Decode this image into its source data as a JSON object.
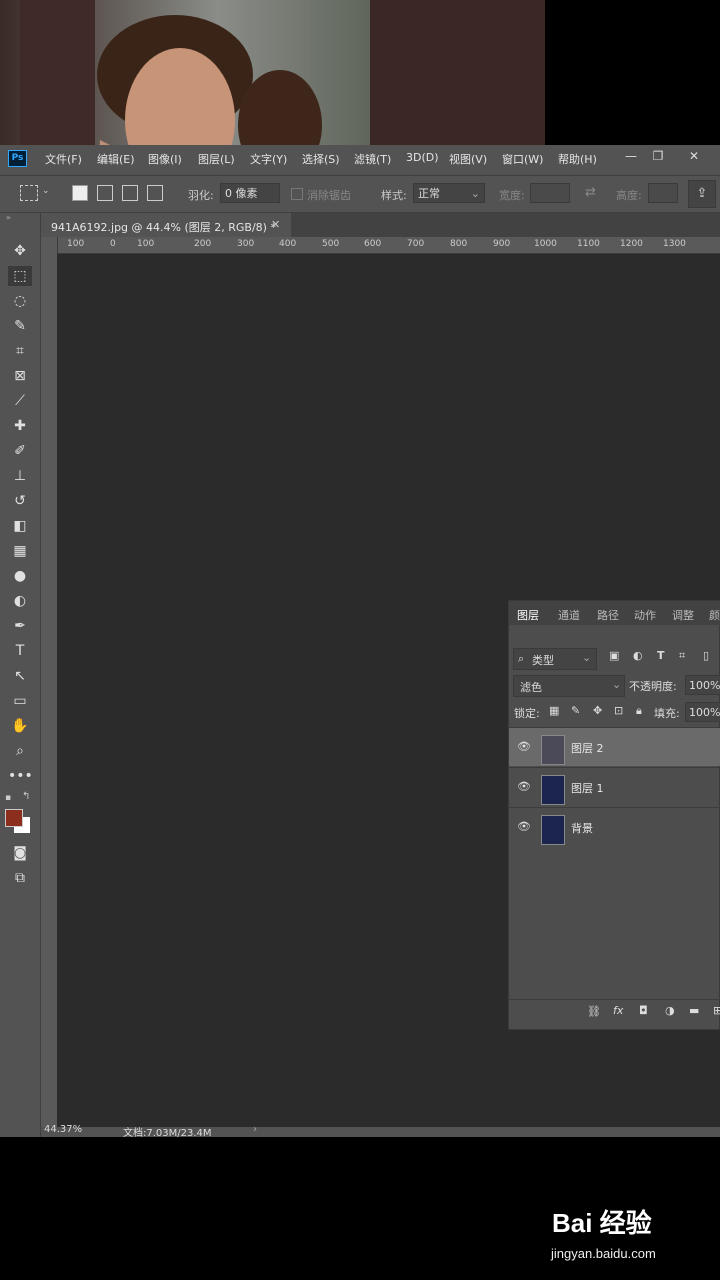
{
  "menubar": {
    "app_icon": "Ps",
    "items": [
      "文件(F)",
      "编辑(E)",
      "图像(I)",
      "图层(L)",
      "文字(Y)",
      "选择(S)",
      "滤镜(T)",
      "3D(D)",
      "视图(V)",
      "窗口(W)",
      "帮助(H)"
    ],
    "window_controls": [
      "minimize-icon",
      "restore-icon",
      "close-icon"
    ]
  },
  "options": {
    "feather_label": "羽化:",
    "feather_value": "0 像素",
    "antialias_label": "消除锯齿",
    "style_label": "样式:",
    "style_value": "正常",
    "width_label": "宽度:",
    "height_label": "高度:"
  },
  "document": {
    "tab_title": "941A6192.jpg @ 44.4% (图层 2, RGB/8) *",
    "ruler_ticks": [
      "100",
      "0",
      "100",
      "200",
      "300",
      "400",
      "500",
      "600",
      "700",
      "800",
      "900",
      "1000",
      "1100",
      "1200",
      "1300"
    ]
  },
  "status": {
    "zoom": "44.37%",
    "doc_info": "文档:7.03M/23.4M"
  },
  "layers_panel": {
    "tabs": [
      "图层",
      "通道",
      "路径",
      "动作",
      "调整",
      "颜"
    ],
    "filter_label": "类型",
    "blend_mode": "滤色",
    "opacity_label": "不透明度:",
    "opacity_value": "100%",
    "lock_label": "锁定:",
    "fill_label": "填充:",
    "fill_value": "100%",
    "layers": [
      {
        "name": "图层 2",
        "selected": true
      },
      {
        "name": "图层 1",
        "selected": false
      },
      {
        "name": "背景",
        "selected": false
      }
    ]
  },
  "watermark": {
    "brand": "Bai 经验",
    "url": "jingyan.baidu.com"
  }
}
